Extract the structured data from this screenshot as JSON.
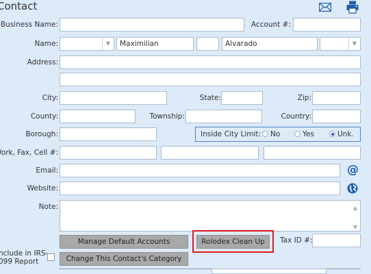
{
  "header": {
    "title": "Contact",
    "email_icon": "envelope-icon",
    "print_icon": "printer-icon"
  },
  "labels": {
    "business_name": "Business Name:",
    "account": "Account #:",
    "name": "Name:",
    "address": "Address:",
    "city": "City:",
    "state": "State:",
    "zip": "Zip:",
    "county": "County:",
    "township": "Township:",
    "country": "Country:",
    "borough": "Borough:",
    "inside_city_limit": "Inside City Limit:",
    "work_fax_cell": "Work, Fax, Cell #:",
    "email": "Email:",
    "website": "Website:",
    "note": "Note:",
    "tax_id": "Tax ID #:",
    "include_irs_line1": "nclude in IRS-",
    "include_irs_line2": "099 Report"
  },
  "fields": {
    "business_name": "",
    "account": "",
    "name_prefix": "",
    "first_name": "Maximilian",
    "middle_initial": "",
    "last_name": "Alvarado",
    "name_suffix": "",
    "address1": "",
    "address2": "",
    "city": "",
    "state": "",
    "zip": "",
    "county": "",
    "township": "",
    "country": "",
    "borough": "",
    "work_phone": "",
    "fax": "",
    "cell": "",
    "email": "",
    "website": "",
    "note": "",
    "tax_id": ""
  },
  "inside_city_limit": {
    "options": [
      "No",
      "Yes",
      "Unk."
    ],
    "selected": "Unk."
  },
  "buttons": {
    "manage_defaults": "Manage Default Accounts",
    "rolodex_cleanup": "Rolodex Clean Up",
    "change_category": "Change This Contact's Category"
  },
  "icons": {
    "email_at": "at-icon",
    "website_globe": "globe-icon"
  },
  "colors": {
    "background": "#ddeaf8",
    "accent": "#1e5fa8",
    "highlight": "#e0191f",
    "button": "#a9a9a9"
  }
}
